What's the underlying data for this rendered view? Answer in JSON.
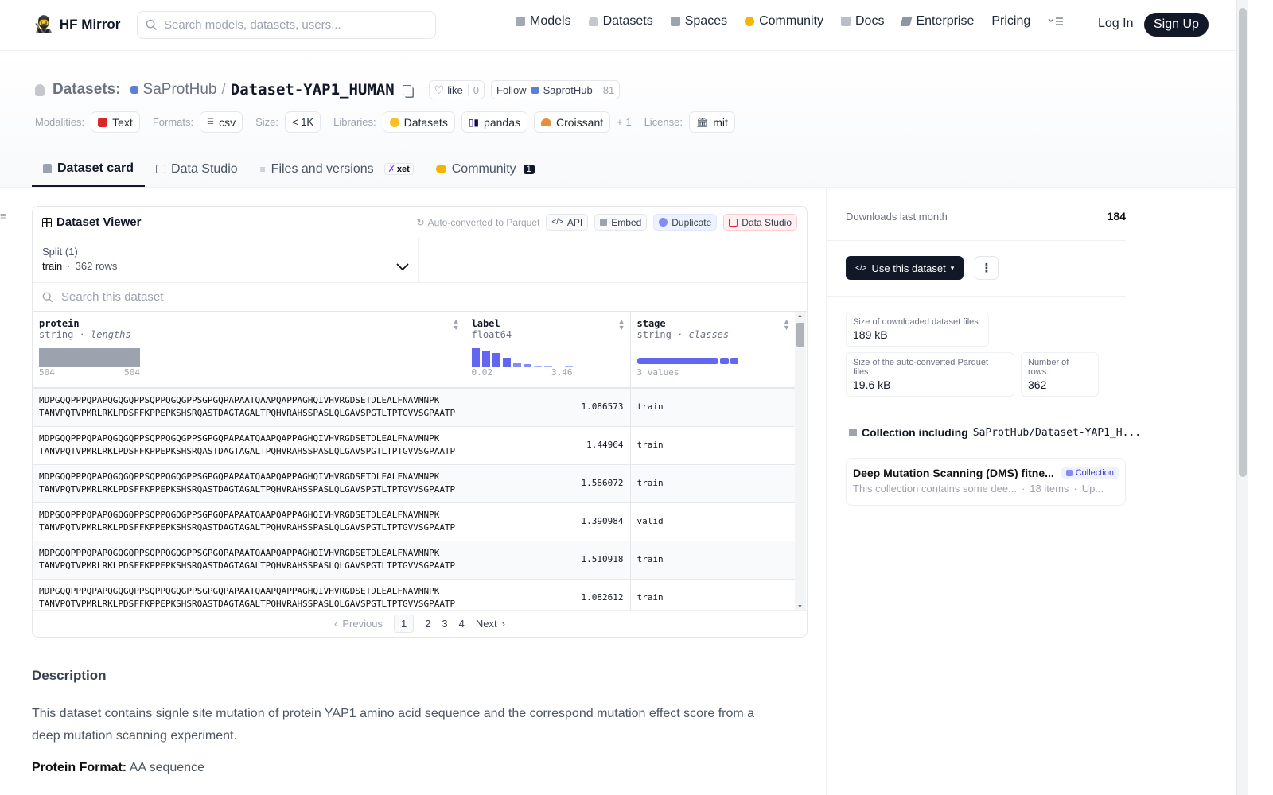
{
  "header": {
    "brand": "HF Mirror",
    "search_placeholder": "Search models, datasets, users...",
    "nav": [
      {
        "label": "Models",
        "icon": "models-icon",
        "color": "#a3a9b4"
      },
      {
        "label": "Datasets",
        "icon": "datasets-icon",
        "color": "#c4c8ce"
      },
      {
        "label": "Spaces",
        "icon": "spaces-icon",
        "color": "#9aa3af"
      },
      {
        "label": "Community",
        "icon": "community-icon",
        "color": "#f5b400"
      },
      {
        "label": "Docs",
        "icon": "docs-icon",
        "color": "#b9bfc8"
      },
      {
        "label": "Enterprise",
        "icon": "enterprise-icon",
        "color": "#8d96a3"
      },
      {
        "label": "Pricing",
        "icon": "",
        "color": ""
      }
    ],
    "login": "Log In",
    "signup": "Sign Up"
  },
  "dataset": {
    "section": "Datasets:",
    "owner": "SaProtHub",
    "sep": "/",
    "name": "Dataset-YAP1_HUMAN",
    "like_label": "like",
    "like_count": "0",
    "follow_label": "Follow",
    "follow_org": "SaprotHub",
    "follow_count": "81",
    "modalities_label": "Modalities:",
    "modality": "Text",
    "formats_label": "Formats:",
    "format": "csv",
    "size_label": "Size:",
    "size": "< 1K",
    "libraries_label": "Libraries:",
    "libraries": [
      "Datasets",
      "pandas",
      "Croissant"
    ],
    "libraries_more": "+ 1",
    "license_label": "License:",
    "license": "mit"
  },
  "tabs": [
    {
      "label": "Dataset card",
      "active": true
    },
    {
      "label": "Data Studio",
      "active": false
    },
    {
      "label": "Files and versions",
      "active": false,
      "badge": "xet"
    },
    {
      "label": "Community",
      "active": false,
      "badge": "1"
    }
  ],
  "viewer": {
    "title": "Dataset Viewer",
    "autoconv_link": "Auto-converted",
    "autoconv_rest": "to Parquet",
    "buttons": [
      "API",
      "Embed",
      "Duplicate",
      "Data Studio"
    ],
    "split_label": "Split (1)",
    "split_value": "train",
    "split_dot": "·",
    "split_rows": "362 rows",
    "search_placeholder": "Search this dataset",
    "columns": [
      {
        "name": "protein",
        "type": "string",
        "sub": "lengths",
        "min": "504",
        "max": "504"
      },
      {
        "name": "label",
        "type": "float64",
        "sub": "",
        "min": "0.02",
        "max": "3.46"
      },
      {
        "name": "stage",
        "type": "string",
        "sub": "classes",
        "min": "3 values",
        "max": ""
      }
    ],
    "rows": [
      {
        "seq1": "MDPGQQPPPQPAPQGQGQPPSQPPQGQGPPSGPGQPAPAATQAAPQAPPAGHQIVHVRGDSETDLEALFNAVMNPK",
        "seq2": "TANVPQTVPMRLRKLPDSFFKPPEPKSHSRQASTDAGTAGALTPQHVRAHSSPASLQLGAVSPGTLTPTGVVSGPAATP",
        "label": "1.086573",
        "stage": "train"
      },
      {
        "seq1": "MDPGQQPPPQPAPQGQGQPPSQPPQGQGPPSGPGQPAPAATQAAPQAPPAGHQIVHVRGDSETDLEALFNAVMNPK",
        "seq2": "TANVPQTVPMRLRKLPDSFFKPPEPKSHSRQASTDAGTAGALTPQHVRAHSSPASLQLGAVSPGTLTPTGVVSGPAATP",
        "label": "1.44964",
        "stage": "train"
      },
      {
        "seq1": "MDPGQQPPPQPAPQGQGQPPSQPPQGQGPPSGPGQPAPAATQAAPQAPPAGHQIVHVRGDSETDLEALFNAVMNPK",
        "seq2": "TANVPQTVPMRLRKLPDSFFKPPEPKSHSRQASTDAGTAGALTPQHVRAHSSPASLQLGAVSPGTLTPTGVVSGPAATP",
        "label": "1.586072",
        "stage": "train"
      },
      {
        "seq1": "MDPGQQPPPQPAPQGQGQPPSQPPQGQGPPSGPGQPAPAATQAAPQAPPAGHQIVHVRGDSETDLEALFNAVMNPK",
        "seq2": "TANVPQTVPMRLRKLPDSFFKPPEPKSHSRQASTDAGTAGALTPQHVRAHSSPASLQLGAVSPGTLTPTGVVSGPAATP",
        "label": "1.390984",
        "stage": "valid"
      },
      {
        "seq1": "MDPGQQPPPQPAPQGQGQPPSQPPQGQGPPSGPGQPAPAATQAAPQAPPAGHQIVHVRGDSETDLEALFNAVMNPK",
        "seq2": "TANVPQTVPMRLRKLPDSFFKPPEPKSHSRQASTDAGTAGALTPQHVRAHSSPASLQLGAVSPGTLTPTGVVSGPAATP",
        "label": "1.510918",
        "stage": "train"
      },
      {
        "seq1": "MDPGQQPPPQPAPQGQGQPPSQPPQGQGPPSGPGQPAPAATQAAPQAPPAGHQIVHVRGDSETDLEALFNAVMNPK",
        "seq2": "TANVPQTVPMRLRKLPDSFFKPPEPKSHSRQASTDAGTAGALTPQHVRAHSSPASLQLGAVSPGTLTPTGVVSGPAATP",
        "label": "1.082612",
        "stage": "train"
      }
    ],
    "pager": {
      "prev": "Previous",
      "pages": [
        "1",
        "2",
        "3",
        "4"
      ],
      "next": "Next"
    }
  },
  "description": {
    "heading": "Description",
    "text": "This dataset contains signle site mutation of protein YAP1 amino acid sequence and the correspond mutation effect score from a deep mutation scanning experiment.",
    "format_label": "Protein Format:",
    "format_value": "AA sequence"
  },
  "sidebar": {
    "downloads_label": "Downloads last month",
    "downloads_value": "184",
    "use_button": "Use this dataset",
    "size_dl_label": "Size of downloaded dataset files:",
    "size_dl_value": "189 kB",
    "size_pq_label": "Size of the auto-converted Parquet files:",
    "size_pq_value": "19.6 kB",
    "rows_label": "Number of rows:",
    "rows_value": "362",
    "collection_heading": "Collection including",
    "collection_ref": "SaProtHub/Dataset-YAP1_H...",
    "collection_title": "Deep Mutation Scanning (DMS) fitne...",
    "collection_badge": "Collection",
    "collection_desc": "This collection contains some dee...",
    "collection_items": "18 items",
    "collection_updated": "Up..."
  }
}
